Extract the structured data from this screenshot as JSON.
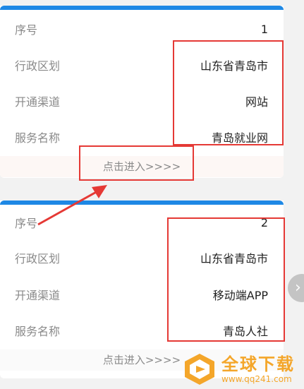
{
  "cards": [
    {
      "rows": [
        {
          "label": "序号",
          "value": "1"
        },
        {
          "label": "行政区划",
          "value": "山东省青岛市"
        },
        {
          "label": "开通渠道",
          "value": "网站"
        },
        {
          "label": "服务名称",
          "value": "青岛就业网"
        }
      ],
      "enter_label": "点击进入>>>>"
    },
    {
      "rows": [
        {
          "label": "序号",
          "value": "2"
        },
        {
          "label": "行政区划",
          "value": "山东省青岛市"
        },
        {
          "label": "开通渠道",
          "value": "移动端APP"
        },
        {
          "label": "服务名称",
          "value": "青岛人社"
        }
      ],
      "enter_label": "点击进入>>>>"
    }
  ],
  "side_button": {
    "icon": "chevron-right-icon",
    "glyph": "›"
  },
  "watermark": {
    "title": "全球下载",
    "url": "www.qq241.com"
  },
  "colors": {
    "accent_bar": "#1e88e5",
    "annotation_red": "#e53935",
    "watermark": "#f4a62a"
  }
}
